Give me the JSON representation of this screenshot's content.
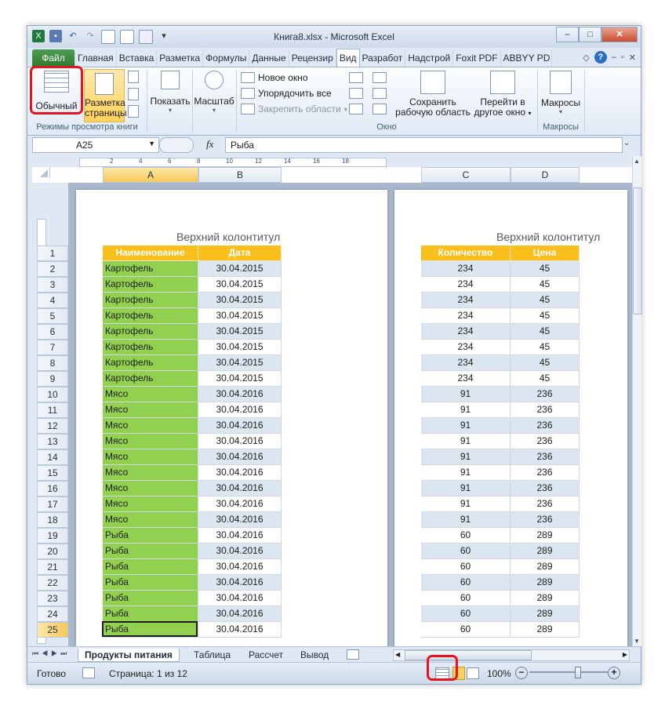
{
  "window": {
    "title": "Книга8.xlsx  -  Microsoft Excel",
    "minimize": "–",
    "restore": "□",
    "close": "✕"
  },
  "tabs": [
    "Файл",
    "Главная",
    "Вставка",
    "Разметка",
    "Формулы",
    "Данные",
    "Рецензир",
    "Вид",
    "Разработ",
    "Надстрой",
    "Foxit PDF",
    "ABBYY PD"
  ],
  "active_tab": "Вид",
  "ribbon": {
    "normal": "Обычный",
    "page_layout_l1": "Разметка",
    "page_layout_l2": "страницы",
    "views_group": "Режимы просмотра книги",
    "show": "Показать",
    "zoom": "Масштаб",
    "new_window": "Новое окно",
    "arrange_all": "Упорядочить все",
    "freeze_panes": "Закрепить области",
    "window_group": "Окно",
    "save_workspace_l1": "Сохранить",
    "save_workspace_l2": "рабочую область",
    "switch_windows_l1": "Перейти в",
    "switch_windows_l2": "другое окно",
    "macros": "Макросы",
    "macros_group": "Макросы"
  },
  "formula_bar": {
    "name_box": "A25",
    "fx": "fx",
    "value": "Рыба"
  },
  "ruler_ticks": [
    "2",
    "4",
    "6",
    "8",
    "10",
    "12",
    "14",
    "16",
    "18"
  ],
  "columns_left": [
    "A",
    "B"
  ],
  "columns_right": [
    "C",
    "D"
  ],
  "header_footer": "Верхний колонтитул",
  "table_headers": [
    "Наименование",
    "Дата",
    "Количество",
    "Цена"
  ],
  "rows": [
    [
      "Картофель",
      "30.04.2015",
      "234",
      "45"
    ],
    [
      "Картофель",
      "30.04.2015",
      "234",
      "45"
    ],
    [
      "Картофель",
      "30.04.2015",
      "234",
      "45"
    ],
    [
      "Картофель",
      "30.04.2015",
      "234",
      "45"
    ],
    [
      "Картофель",
      "30.04.2015",
      "234",
      "45"
    ],
    [
      "Картофель",
      "30.04.2015",
      "234",
      "45"
    ],
    [
      "Картофель",
      "30.04.2015",
      "234",
      "45"
    ],
    [
      "Картофель",
      "30.04.2015",
      "234",
      "45"
    ],
    [
      "Мясо",
      "30.04.2016",
      "91",
      "236"
    ],
    [
      "Мясо",
      "30.04.2016",
      "91",
      "236"
    ],
    [
      "Мясо",
      "30.04.2016",
      "91",
      "236"
    ],
    [
      "Мясо",
      "30.04.2016",
      "91",
      "236"
    ],
    [
      "Мясо",
      "30.04.2016",
      "91",
      "236"
    ],
    [
      "Мясо",
      "30.04.2016",
      "91",
      "236"
    ],
    [
      "Мясо",
      "30.04.2016",
      "91",
      "236"
    ],
    [
      "Мясо",
      "30.04.2016",
      "91",
      "236"
    ],
    [
      "Мясо",
      "30.04.2016",
      "91",
      "236"
    ],
    [
      "Рыба",
      "30.04.2016",
      "60",
      "289"
    ],
    [
      "Рыба",
      "30.04.2016",
      "60",
      "289"
    ],
    [
      "Рыба",
      "30.04.2016",
      "60",
      "289"
    ],
    [
      "Рыба",
      "30.04.2016",
      "60",
      "289"
    ],
    [
      "Рыба",
      "30.04.2016",
      "60",
      "289"
    ],
    [
      "Рыба",
      "30.04.2016",
      "60",
      "289"
    ],
    [
      "Рыба",
      "30.04.2016",
      "60",
      "289"
    ]
  ],
  "selected_row": "25",
  "sheet_tabs": [
    "Продукты питания",
    "Таблица",
    "Рассчет",
    "Вывод"
  ],
  "status": {
    "ready": "Готово",
    "page": "Страница: 1 из 12",
    "zoom": "100%"
  },
  "colors": {
    "header_orange": "#fbbf1d",
    "name_green": "#92d050",
    "band_blue": "#dce6f1",
    "highlight_red": "#e8131f",
    "file_tab": "#2f7d33"
  }
}
